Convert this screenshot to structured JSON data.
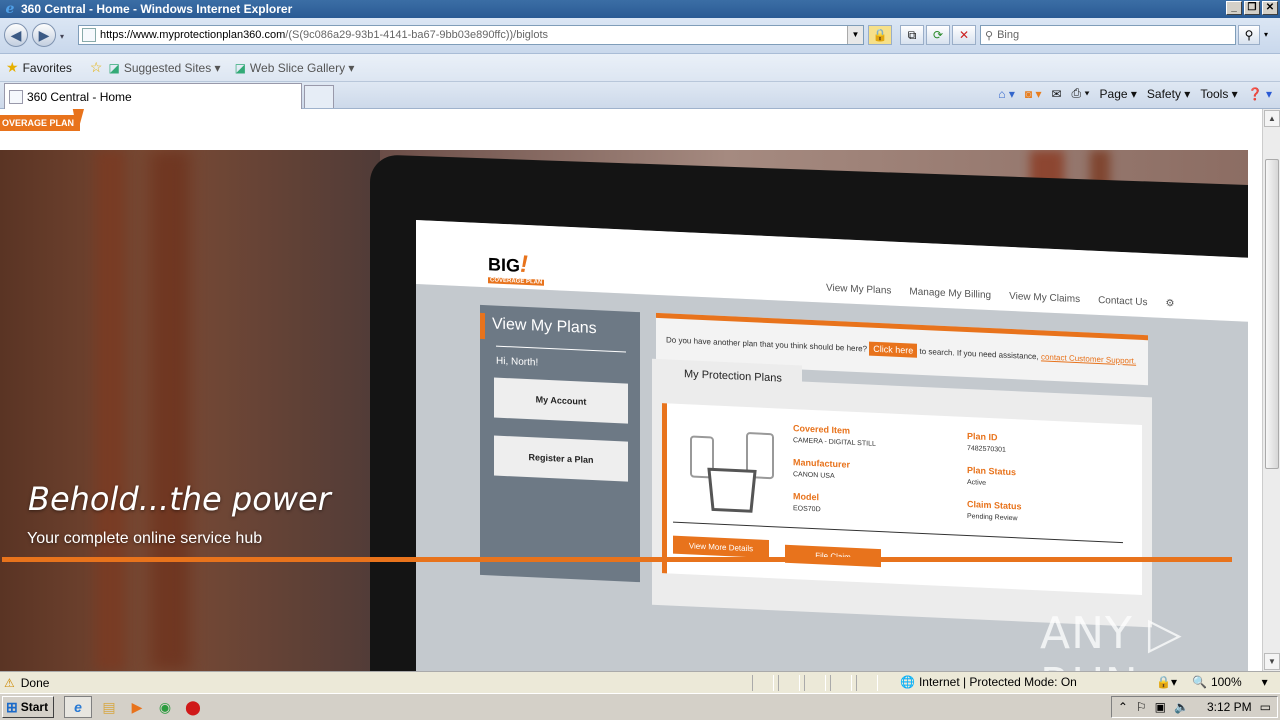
{
  "window": {
    "title": "360 Central - Home - Windows Internet Explorer",
    "controls": [
      "_",
      "❐",
      "✕"
    ]
  },
  "nav": {
    "address_host": "https://www.myprotectionplan360.com",
    "address_rest": "/(S(9c086a29-93b1-4141-ba67-9bb03e890ffc))/biglots",
    "search_placeholder": "Bing"
  },
  "favorites": {
    "favorites_label": "Favorites",
    "suggested_sites": "Suggested Sites ▾",
    "web_slice_gallery": "Web Slice Gallery ▾"
  },
  "tabs": {
    "active_tab": "360 Central - Home"
  },
  "commands": {
    "page": "Page ▾",
    "safety": "Safety ▾",
    "tools": "Tools ▾"
  },
  "site": {
    "badge_text": "OVERAGE PLAN",
    "hero_title": "Behold...the power",
    "hero_subtitle": "Your complete online service hub"
  },
  "mock_screen": {
    "logo": "BIG",
    "logo_sub": "COVERAGE PLAN",
    "nav": [
      "View My Plans",
      "Manage My Billing",
      "View My Claims",
      "Contact Us"
    ],
    "sidebar_title": "View My Plans",
    "greeting": "Hi, North!",
    "my_account": "My Account",
    "register_plan": "Register a Plan",
    "notice_pre": "Do you have another plan that you think should be here?",
    "click_here": "Click here",
    "notice_post": "to search. If you need assistance,",
    "contact_link": "contact Customer Support.",
    "panel_tab": "My Protection Plans",
    "covered_item_label": "Covered Item",
    "covered_item_value": "CAMERA - DIGITAL STILL",
    "manufacturer_label": "Manufacturer",
    "manufacturer_value": "CANON USA",
    "model_label": "Model",
    "model_value": "EOS70D",
    "plan_id_label": "Plan ID",
    "plan_id_value": "7482570301",
    "plan_status_label": "Plan Status",
    "plan_status_value": "Active",
    "claim_status_label": "Claim Status",
    "claim_status_value": "Pending Review",
    "view_details": "View More Details",
    "file_claim": "File Claim"
  },
  "watermark": "ANY ▷ RUN",
  "status": {
    "done": "Done",
    "zone": "Internet | Protected Mode: On",
    "zoom": "100%"
  },
  "taskbar": {
    "start": "Start",
    "clock": "3:12 PM"
  },
  "colors": {
    "accent": "#e8731c",
    "ie_title": "#2a5a94"
  }
}
